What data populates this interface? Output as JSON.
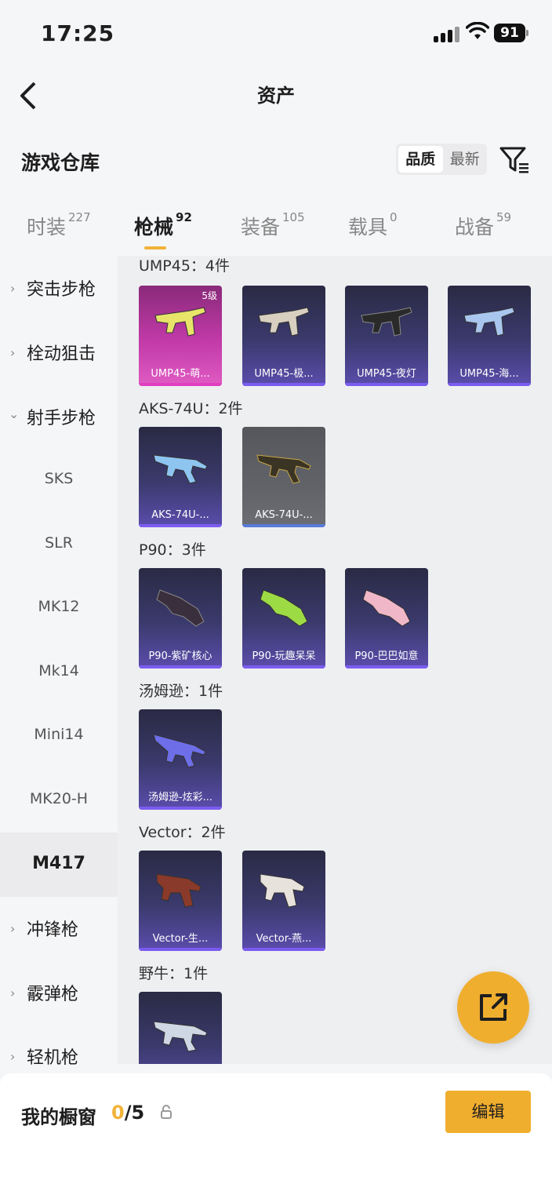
{
  "status_bar": {
    "time": "17:25",
    "battery": "91"
  },
  "nav": {
    "title": "资产"
  },
  "section": {
    "title": "游戏仓库",
    "sort_quality": "品质",
    "sort_latest": "最新"
  },
  "tabs": [
    {
      "label": "时装",
      "count": "227"
    },
    {
      "label": "枪械",
      "count": "92"
    },
    {
      "label": "装备",
      "count": "105"
    },
    {
      "label": "载具",
      "count": "0"
    },
    {
      "label": "战备",
      "count": "59"
    }
  ],
  "sidebar": [
    {
      "label": "突击步枪"
    },
    {
      "label": "栓动狙击"
    },
    {
      "label": "射手步枪"
    },
    {
      "label": "SKS"
    },
    {
      "label": "SLR"
    },
    {
      "label": "MK12"
    },
    {
      "label": "Mk14"
    },
    {
      "label": "Mini14"
    },
    {
      "label": "MK20-H"
    },
    {
      "label": "M417"
    },
    {
      "label": "冲锋枪"
    },
    {
      "label": "霰弹枪"
    },
    {
      "label": "轻机枪"
    }
  ],
  "groups": [
    {
      "title": "UMP45：4件",
      "items": [
        {
          "name": "UMP45-萌...",
          "level": "5级",
          "color": "#e8e46a"
        },
        {
          "name": "UMP45-极...",
          "color": "#d8cfc0"
        },
        {
          "name": "UMP45-夜灯",
          "color": "#2a2a2a"
        },
        {
          "name": "UMP45-海...",
          "color": "#a9c6ef"
        }
      ]
    },
    {
      "title": "AKS-74U：2件",
      "items": [
        {
          "name": "AKS-74U-...",
          "color": "#8ec5f0"
        },
        {
          "name": "AKS-74U-...",
          "color": "#3a3424"
        }
      ]
    },
    {
      "title": "P90：3件",
      "items": [
        {
          "name": "P90-紫矿核心",
          "color": "#3a2f3c"
        },
        {
          "name": "P90-玩趣呆呆",
          "color": "#9ddb45"
        },
        {
          "name": "P90-巴巴如意",
          "color": "#f0b7c9"
        }
      ]
    },
    {
      "title": "汤姆逊：1件",
      "items": [
        {
          "name": "汤姆逊-炫彩...",
          "color": "#6d6ee8"
        }
      ]
    },
    {
      "title": "Vector：2件",
      "items": [
        {
          "name": "Vector-生...",
          "color": "#8a3a2a"
        },
        {
          "name": "Vector-燕...",
          "color": "#e7e2dc"
        }
      ]
    },
    {
      "title": "野牛：1件",
      "items": [
        {
          "name": "",
          "color": "#cfd6e4"
        }
      ]
    }
  ],
  "showcase": {
    "label": "我的橱窗",
    "current": "0",
    "total": "/5",
    "edit_label": "编辑"
  },
  "colors": {
    "accent": "#f0ae2f",
    "purple": "#5b4dad"
  }
}
